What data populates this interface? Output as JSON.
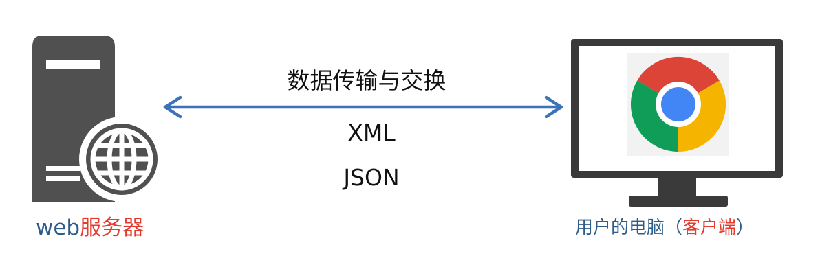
{
  "server": {
    "label_prefix": "web",
    "label_main": "服务器"
  },
  "transfer": {
    "title": "数据传输与交换",
    "formats": [
      "XML",
      "JSON"
    ]
  },
  "client": {
    "label_prefix": "用户的电脑（",
    "label_highlight": "客户端",
    "label_suffix": "）"
  },
  "colors": {
    "server_body": "#505050",
    "arrow": "#3b72b8",
    "label_blue": "#2e5c8a",
    "label_red": "#e53a2e",
    "monitor": "#3a3a3a"
  },
  "icons": {
    "server": "server-globe-icon",
    "browser": "chrome-logo-icon"
  }
}
